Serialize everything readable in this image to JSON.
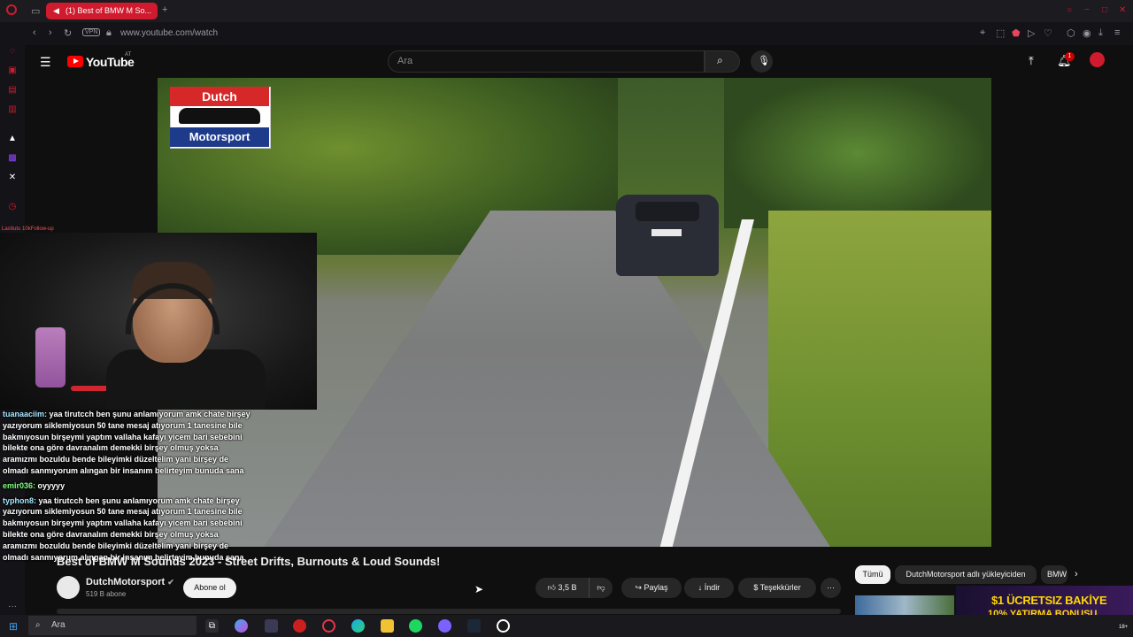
{
  "browser": {
    "tab_title": "(1) Best of BMW M So...",
    "url": "www.youtube.com/watch",
    "vpn_label": "VPN",
    "notification_count": "1"
  },
  "youtube": {
    "logo_text": "YouTube",
    "country_code": "AT",
    "search_placeholder": "Ara"
  },
  "video": {
    "brand_top": "Dutch",
    "brand_bottom": "Motorsport",
    "plate_text": ""
  },
  "overlay": {
    "cam_label": "Lasttutu 10kFollow-up",
    "chat": [
      {
        "user": "tuanaaciim:",
        "text": "yaa tirutcch ben şunu anlamıyorum amk chate birşey yazıyorum siklemiyosun 50 tane mesaj atıyorum 1 tanesine bile bakmıyosun birşeymi yaptım vallaha kafayı yicem bari sebebini bilekte ona göre davranalım demekki birşey olmuş yoksa aramızmı bozuldu bende bileyimki düzeltelim yani birşey de olmadı sanmıyorum alıngan bir insanım belirteyim bunuda sana"
      },
      {
        "user": "emir036:",
        "text": "oyyyyy"
      },
      {
        "user": "typhon8:",
        "text": "yaa tirutcch ben şunu anlamıyorum amk chate birşey yazıyorum siklemiyosun 50 tane mesaj atıyorum 1 tanesine bile bakmıyosun birşeymi yaptım vallaha kafayı yicem bari sebebini bilekte ona göre davranalım demekki birşey olmuş yoksa aramızmı bozuldu bende bileyimki düzeltelim yani birşey de olmadı sanmıyorum alıngan bir insanım belirteyim bunuda sana"
      }
    ]
  },
  "watch": {
    "title": "Best of BMW M Sounds 2023 - Street Drifts, Burnouts & Loud Sounds!",
    "channel_name": "DutchMotorsport",
    "subscribers": "519 B abone",
    "subscribe_label": "Abone ol",
    "like_count": "3,5 B",
    "share_label": "Paylaş",
    "download_label": "İndir",
    "thanks_label": "Teşekkürler",
    "more_label": "···"
  },
  "recommendations": {
    "chips": [
      "Tümü",
      "DutchMotorsport adlı yükleyiciden",
      "BMW"
    ],
    "ad_line1": "$1 ÜCRETSIZ BAKİYE",
    "ad_line2": "10% YATIRMA BONUSU"
  },
  "taskbar": {
    "search_label": "Ara",
    "badge": "18+"
  }
}
